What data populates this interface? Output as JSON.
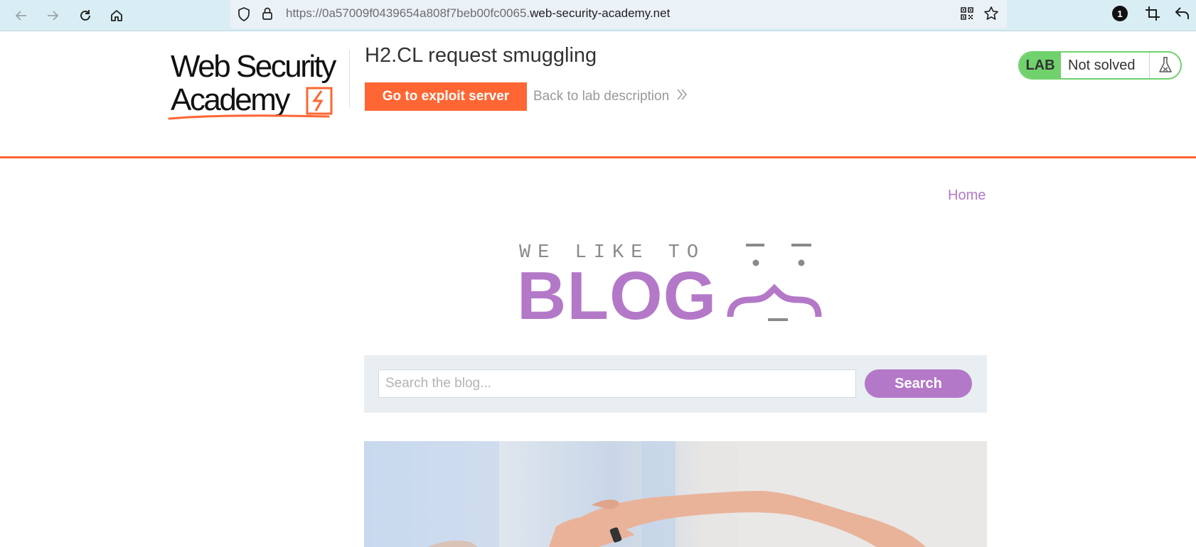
{
  "browser": {
    "url_prefix": "https://0a57009f0439654a808f7beb00fc0065.",
    "url_domain": "web-security-academy.net",
    "notification_count": "1"
  },
  "lab": {
    "logo_line1": "Web Security",
    "logo_line2": "Academy",
    "title": "H2.CL request smuggling",
    "exploit_button": "Go to exploit server",
    "back_link": "Back to lab description",
    "status_tag": "LAB",
    "status_text": "Not solved"
  },
  "blog": {
    "home_link": "Home",
    "logo_tagline": "WE LIKE TO",
    "logo_word": "BLOG",
    "search_placeholder": "Search the blog...",
    "search_button": "Search"
  },
  "colors": {
    "accent_orange": "#ff6633",
    "blog_purple": "#b478c8",
    "lab_green": "#70d16d",
    "browser_bar": "#d9eef4"
  }
}
